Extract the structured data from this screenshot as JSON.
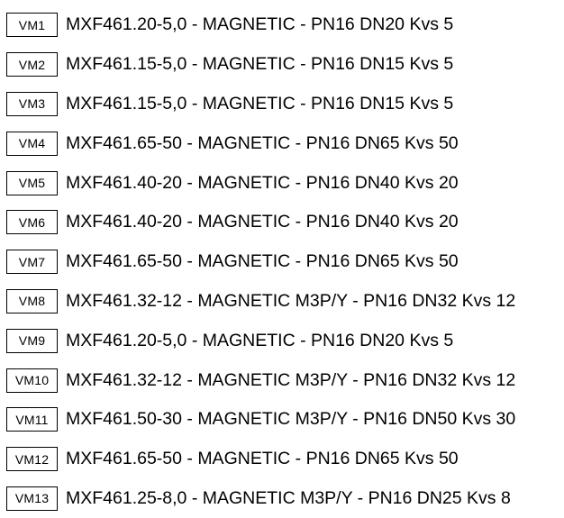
{
  "legend": {
    "items": [
      {
        "code": "VM1",
        "description": "MXF461.20-5,0 - MAGNETIC - PN16 DN20 Kvs 5"
      },
      {
        "code": "VM2",
        "description": "MXF461.15-5,0 - MAGNETIC - PN16 DN15 Kvs 5"
      },
      {
        "code": "VM3",
        "description": "MXF461.15-5,0 - MAGNETIC - PN16 DN15 Kvs 5"
      },
      {
        "code": "VM4",
        "description": "MXF461.65-50 - MAGNETIC - PN16 DN65 Kvs 50"
      },
      {
        "code": "VM5",
        "description": "MXF461.40-20 - MAGNETIC - PN16 DN40 Kvs 20"
      },
      {
        "code": "VM6",
        "description": "MXF461.40-20 - MAGNETIC - PN16 DN40 Kvs 20"
      },
      {
        "code": "VM7",
        "description": "MXF461.65-50 - MAGNETIC - PN16 DN65 Kvs 50"
      },
      {
        "code": "VM8",
        "description": "MXF461.32-12 - MAGNETIC M3P/Y - PN16 DN32 Kvs 12"
      },
      {
        "code": "VM9",
        "description": "MXF461.20-5,0 - MAGNETIC - PN16 DN20 Kvs 5"
      },
      {
        "code": "VM10",
        "description": "MXF461.32-12 - MAGNETIC M3P/Y - PN16 DN32 Kvs 12"
      },
      {
        "code": "VM11",
        "description": "MXF461.50-30 - MAGNETIC M3P/Y - PN16 DN50 Kvs 30"
      },
      {
        "code": "VM12",
        "description": "MXF461.65-50 - MAGNETIC - PN16 DN65 Kvs 50"
      },
      {
        "code": "VM13",
        "description": "MXF461.25-8,0 - MAGNETIC M3P/Y - PN16 DN25 Kvs 8"
      }
    ]
  }
}
